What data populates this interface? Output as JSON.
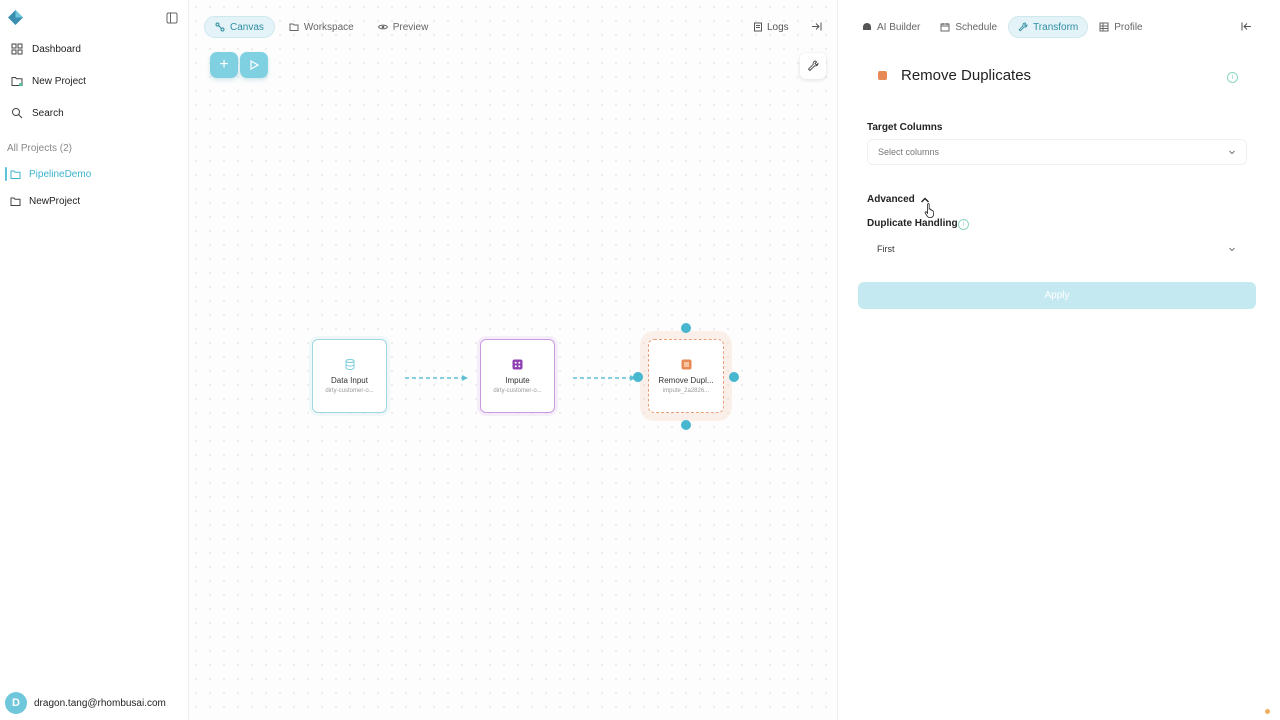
{
  "sidebar": {
    "nav": [
      {
        "label": "Dashboard",
        "icon": "grid-icon"
      },
      {
        "label": "New Project",
        "icon": "new-project-icon"
      },
      {
        "label": "Search",
        "icon": "search-icon"
      }
    ],
    "projects_title": "All Projects (2)",
    "projects": [
      {
        "label": "PipelineDemo",
        "active": true
      },
      {
        "label": "NewProject",
        "active": false
      }
    ],
    "user": {
      "initial": "D",
      "email": "dragon.tang@rhombusai.com"
    }
  },
  "canvas": {
    "tabs": [
      {
        "label": "Canvas",
        "icon": "canvas-icon",
        "active": true
      },
      {
        "label": "Workspace",
        "icon": "folder-icon",
        "active": false
      },
      {
        "label": "Preview",
        "icon": "eye-icon",
        "active": false
      }
    ],
    "logs_label": "Logs",
    "add_label": "+",
    "nodes": [
      {
        "title": "Data Input",
        "subtitle": "dirty-customer-o...",
        "color": "#9fd7e3"
      },
      {
        "title": "Impute",
        "subtitle": "dirty-customer-o...",
        "color": "#c89be0"
      },
      {
        "title": "Remove Dupl...",
        "subtitle": "impute_2a2826...",
        "color": "#e8a07c"
      }
    ]
  },
  "panel": {
    "tabs": [
      {
        "label": "AI Builder",
        "icon": "ai-builder-icon",
        "active": false
      },
      {
        "label": "Schedule",
        "icon": "calendar-icon",
        "active": false
      },
      {
        "label": "Transform",
        "icon": "wrench-icon",
        "active": true
      },
      {
        "label": "Profile",
        "icon": "table-icon",
        "active": false
      }
    ],
    "title": "Remove Duplicates",
    "target_columns_label": "Target Columns",
    "target_columns_placeholder": "Select columns",
    "advanced_label": "Advanced",
    "duplicate_handling_label": "Duplicate Handling",
    "duplicate_handling_value": "First",
    "apply_label": "Apply",
    "accent": "#3fb3cb"
  }
}
